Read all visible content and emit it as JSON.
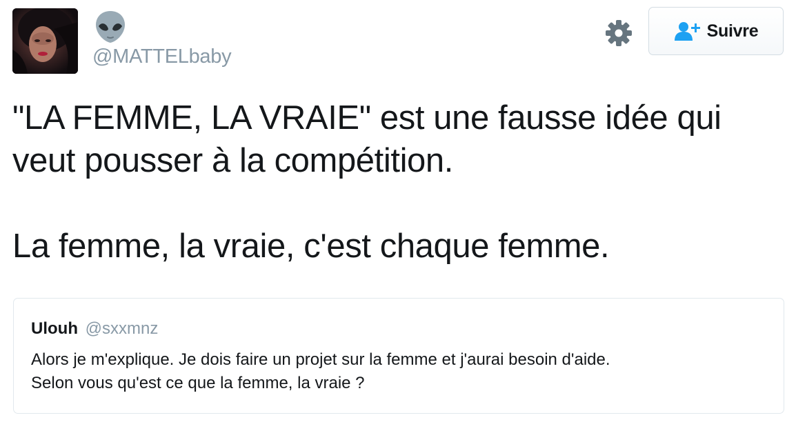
{
  "author": {
    "display_name_icon": "alien-emoji-icon",
    "handle": "@MATTELbaby",
    "avatar": "profile-photo"
  },
  "actions": {
    "settings_icon": "gear-icon",
    "follow_icon": "add-user-icon",
    "follow_label": "Suivre"
  },
  "tweet": {
    "paragraphs": [
      "\"LA FEMME, LA VRAIE\" est une fausse idée qui veut pousser à la compétition.",
      "La femme, la vraie, c'est chaque femme."
    ]
  },
  "quoted_tweet": {
    "name": "Ulouh",
    "handle": "@sxxmnz",
    "lines": [
      "Alors je m'explique. Je dois faire un projet sur la femme et j'aurai besoin d'aide.",
      "Selon vous qu'est ce que la femme, la vraie ?"
    ]
  },
  "colors": {
    "text": "#14171a",
    "secondary": "#8899a6",
    "follow_icon": "#1da1f2",
    "border": "#e1e8ed"
  }
}
